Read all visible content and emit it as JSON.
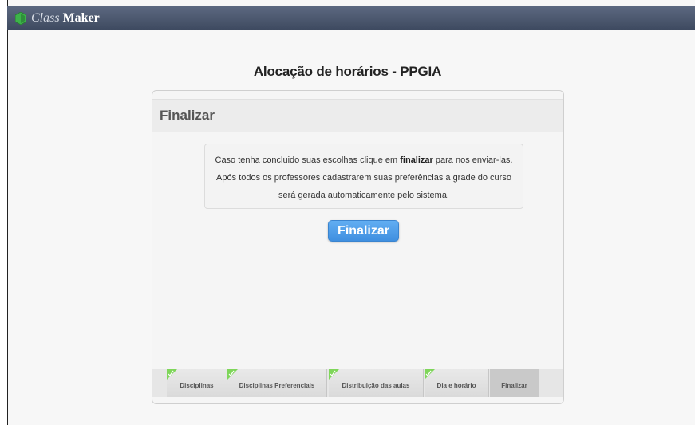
{
  "app": {
    "brand_light": "Class",
    "brand_bold": "Maker",
    "logo_color": "#3db34a"
  },
  "page": {
    "title": "Alocação de horários - PPGIA"
  },
  "card": {
    "title": "Finalizar",
    "message_before": "Caso tenha concluido suas escolhas clique em ",
    "message_bold": "finalizar",
    "message_after": " para nos enviar-las. Após todos os professores cadastrarem suas preferências a grade do curso será gerada automaticamente pelo sistema.",
    "button_label": "Finalizar",
    "button_color": "#4a9be8"
  },
  "steps": [
    {
      "label": "Disciplinas",
      "completed": true,
      "active": false
    },
    {
      "label": "Disciplinas Preferenciais",
      "completed": true,
      "active": false
    },
    {
      "label": "Distribuição das aulas",
      "completed": true,
      "active": false
    },
    {
      "label": "Dia e horário",
      "completed": true,
      "active": false
    },
    {
      "label": "Finalizar",
      "completed": false,
      "active": true
    }
  ],
  "step_check_color": "#7fd65a"
}
